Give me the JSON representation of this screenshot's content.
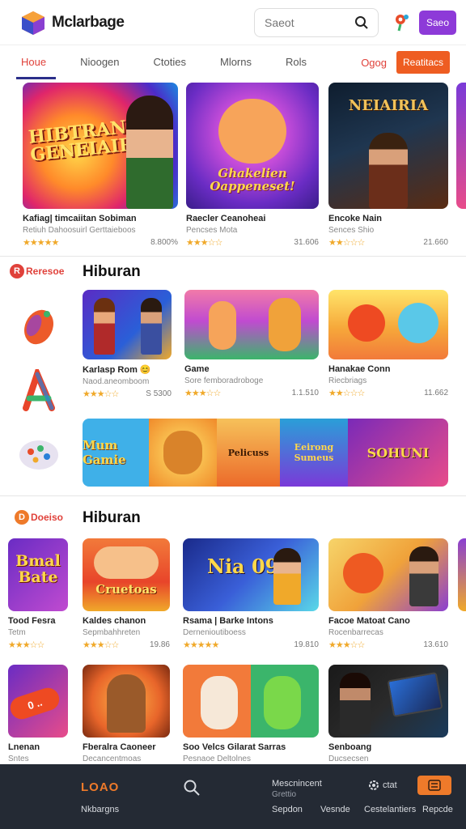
{
  "header": {
    "title": "Mclarbage",
    "search_placeholder": "Saeot",
    "button_label": "Saeo"
  },
  "tabs": {
    "items": [
      {
        "label": "Houe"
      },
      {
        "label": "Nioogen"
      },
      {
        "label": "Ctoties"
      },
      {
        "label": "Mlorns"
      },
      {
        "label": "Rols"
      }
    ],
    "link_label": "Ogog",
    "cta_label": "Reatitacs"
  },
  "featured": [
    {
      "art_text": "HIBTRAN GENEIAIRS",
      "title": "Kafiag| timcaiitan Sobiman",
      "sub": "Retiuh Dahoosuirl Gerttaieboos",
      "stars": "★★★★★",
      "count": "8.800%"
    },
    {
      "art_text": "Ghakelien Oappeneset!",
      "title": "Raecler Ceanoheai",
      "sub": "Pencses Mota",
      "stars": "★★★☆☆",
      "count": "31.606"
    },
    {
      "art_text": "NEIAIRIA",
      "title": "Encoke Nain",
      "sub": "Sences Shio",
      "stars": "★★☆☆☆",
      "count": "21.660"
    }
  ],
  "section1": {
    "badge": "Reresoe",
    "title": "Hiburan",
    "cards": [
      {
        "title": "Karlasp Rom 😊",
        "sub": "Naod.aneomboom",
        "stars": "★★★☆☆",
        "count": "S 5300"
      },
      {
        "title": "Game",
        "sub": "Sore femboradroboge",
        "stars": "★★★☆☆",
        "count": "1.1.510"
      },
      {
        "title": "Hanakae Conn",
        "sub": "Riecbriags",
        "stars": "★★☆☆☆",
        "count": "11.662"
      }
    ],
    "strip": [
      "Mum Gamie",
      "",
      "Pelicuss",
      "Eeirong Sumeus",
      "SOHUNI"
    ]
  },
  "section2": {
    "badge": "Doeiso",
    "title": "Hiburan",
    "row1": [
      {
        "art_text": "Bmal Bate",
        "title": "Tood Fesra",
        "sub": "Tetm",
        "stars": "★★★☆☆",
        "count": ""
      },
      {
        "art_text": "Cruetoas",
        "title": "Kaldes chanon",
        "sub": "Sepmbahhreten",
        "stars": "★★★☆☆",
        "count": "19.86"
      },
      {
        "art_text": "Nia 09",
        "title": "Rsama | Barke Intons",
        "sub": "Dernenioutiboess",
        "stars": "★★★★★",
        "count": "19.810"
      },
      {
        "art_text": "",
        "title": "Facoe Matoat Cano",
        "sub": "Rocenbarrecas",
        "stars": "★★★☆☆",
        "count": "13.610"
      }
    ],
    "row2": [
      {
        "art_text": "0 ..",
        "title": "Lnenan",
        "sub": "Sntes"
      },
      {
        "art_text": "",
        "title": "Fberalra Caoneer",
        "sub": "Decancentmoas"
      },
      {
        "art_text": "",
        "title": "Soo Velcs Gilarat Sarras",
        "sub": "Pesnaoe Deltolnes"
      },
      {
        "art_text": "",
        "title": "Senboang",
        "sub": "Ducsecsen"
      }
    ]
  },
  "bottom_nav": {
    "brand": "LOAO",
    "brand_label": "Nkbargns",
    "center_title": "Mescnincent",
    "center_sub": "Grettio",
    "item1": "Sepdon",
    "item2": "Vesnde",
    "item3": "Cestelantiers",
    "item4": "Repcde",
    "right_label": "ctat"
  },
  "colors": {
    "accent_red": "#e0413a",
    "accent_orange": "#ee5d22",
    "purple": "#8d3ad8",
    "nav_bg": "#242a34"
  }
}
